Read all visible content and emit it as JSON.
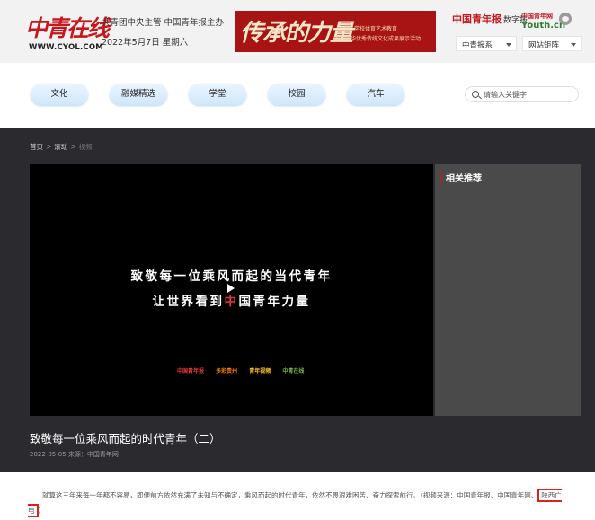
{
  "header": {
    "logo_text": "中青在线",
    "logo_url": "WWW.CYOL.COM",
    "organizer": "共青团中央主管 中国青年报主办",
    "date": "2022年5月7日 星期六",
    "banner": {
      "calligraphy": "传承的力量",
      "line1": "学校体育艺术教育",
      "line2": "弘扬中华优秀传统文化成果展示活动"
    },
    "cyd_logo": "中国青年报",
    "cyd_digital": "数字报",
    "youth_logo": "Youth.cn",
    "youth_sub": "中国青年网",
    "selects": [
      "中青报系",
      "网站矩阵"
    ]
  },
  "nav": {
    "items": [
      "文化",
      "融媒精选",
      "学堂",
      "校园",
      "汽车"
    ],
    "search_placeholder": "请输入关键字"
  },
  "breadcrumb": [
    "首页",
    "滚动",
    "视频"
  ],
  "breadcrumb_sep": ">",
  "video": {
    "line1": "致敬每一位乘风而起的当代青年",
    "line2_a": "让世界看到",
    "line2_hl": "中",
    "line2_b": "国青年力量",
    "logos": [
      "中国青年报",
      "多彩贵州",
      "青年视频",
      "中青在线"
    ]
  },
  "sidebar": {
    "title": "相关推荐"
  },
  "article": {
    "title": "致敬每一位乘风而起的时代青年（二）",
    "meta": "2022-05-05 来源：中国青年网",
    "body": "就算这三年来每一年都不容易，即便前方依然充满了未知与不确定，乘风而起的时代青年，依然不畏艰难困苦、奋力探索前行。（视频来源：中国青年报、中国青年网、",
    "source_highlight": "陕西广电",
    "body_end": "）"
  },
  "colors": {
    "brand_red": "#c8161d",
    "dark_bg": "#2b2b2f",
    "sidebar_bg": "#4a4a4a",
    "pill_blue": "#cfe7fc"
  }
}
